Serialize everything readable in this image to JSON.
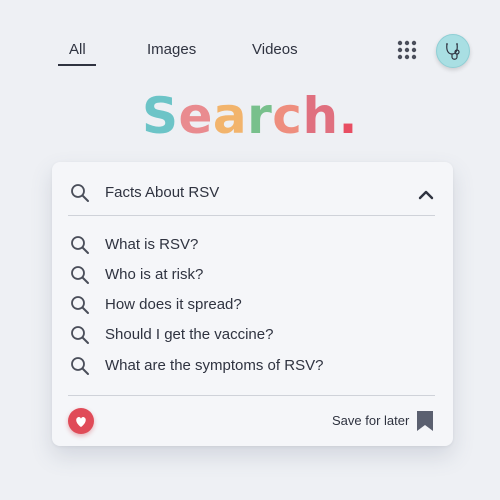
{
  "nav": {
    "tabs": [
      {
        "label": "All",
        "active": true
      },
      {
        "label": "Images",
        "active": false
      },
      {
        "label": "Videos",
        "active": false
      }
    ],
    "apps_icon": "grid-dots-icon",
    "avatar_icon": "doctor-avatar-icon"
  },
  "logo": {
    "text": "Search.",
    "letters": [
      {
        "ch": "S",
        "color": "#6cc4c7"
      },
      {
        "ch": "e",
        "color": "#e98b8f"
      },
      {
        "ch": "a",
        "color": "#f2b46c"
      },
      {
        "ch": "r",
        "color": "#78c08c"
      },
      {
        "ch": "c",
        "color": "#ee8e7e"
      },
      {
        "ch": "h",
        "color": "#e0707f"
      },
      {
        "ch": ".",
        "color": "#e84e62"
      }
    ]
  },
  "search": {
    "query": "Facts About RSV",
    "collapse_icon": "chevron-up-icon",
    "suggestions": [
      "What is RSV?",
      "Who is at risk?",
      "How does it spread?",
      "Should I get the vaccine?",
      "What are the symptoms of RSV?"
    ],
    "save_label": "Save for later",
    "heart_icon": "heart-icon",
    "bookmark_icon": "bookmark-icon"
  },
  "colors": {
    "background": "#eef0f4",
    "card": "#f5f6f9",
    "text": "#2f3340",
    "heart_accent": "#e04b58"
  }
}
